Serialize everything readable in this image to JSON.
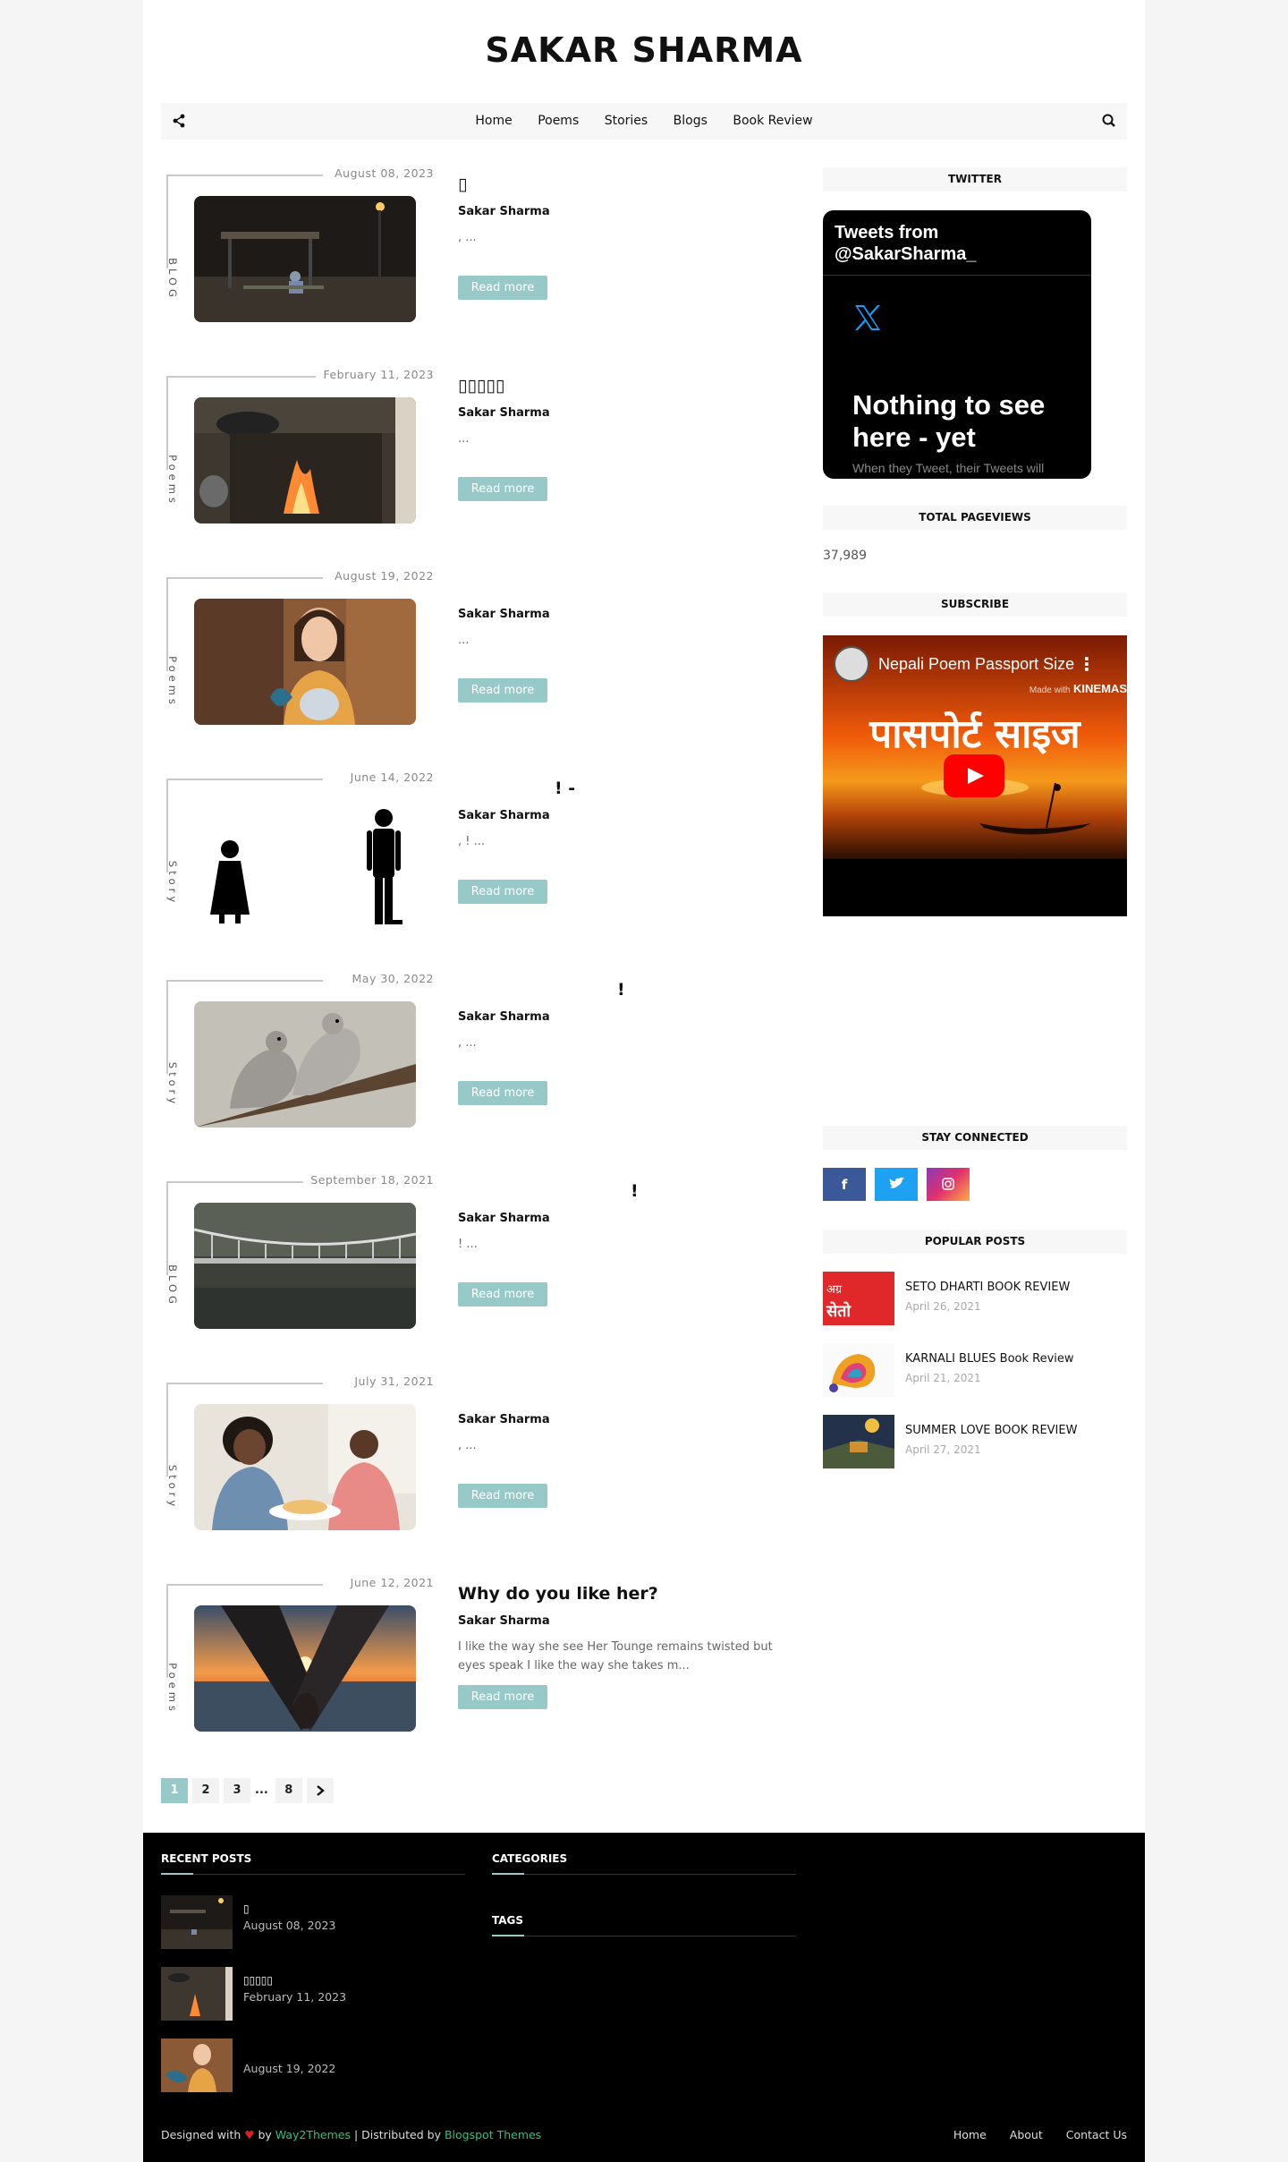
{
  "site": {
    "title": "SAKAR SHARMA"
  },
  "nav": {
    "items": [
      "Home",
      "Poems",
      "Stories",
      "Blogs",
      "Book Review"
    ],
    "share_icon": "share-icon",
    "search_icon": "search-icon"
  },
  "posts": [
    {
      "date": "August 08, 2023",
      "category": "BLOG",
      "title": "▯",
      "author": "Sakar Sharma",
      "snippet": "                                  ,                   ...",
      "read_more": "Read more"
    },
    {
      "date": "February 11, 2023",
      "category": "Poems",
      "title": "▯▯▯▯▯",
      "author": "Sakar Sharma",
      "snippet": "                                                          ...",
      "read_more": "Read more"
    },
    {
      "date": "August 19, 2022",
      "category": "Poems",
      "title": "",
      "author": "Sakar Sharma",
      "snippet": "                                                            ...",
      "read_more": "Read more"
    },
    {
      "date": "June 14, 2022",
      "category": "Story",
      "title": "! -",
      "author": "Sakar Sharma",
      "snippet": "                                                       ,                                     !         ...",
      "read_more": "Read more"
    },
    {
      "date": "May 30, 2022",
      "category": "Story",
      "title": "!",
      "author": "Sakar Sharma",
      "snippet": "                                                            ,                                                          ...",
      "read_more": "Read more"
    },
    {
      "date": "September 18, 2021",
      "category": "BLOG",
      "title": "!",
      "author": "Sakar Sharma",
      "snippet": "                                   !                     ...",
      "read_more": "Read more"
    },
    {
      "date": "July 31, 2021",
      "category": "Story",
      "title": "",
      "author": "Sakar Sharma",
      "snippet": "                                 ,                      ...",
      "read_more": "Read more"
    },
    {
      "date": "June 12, 2021",
      "category": "Poems",
      "title": "Why do you like her?",
      "author": "Sakar Sharma",
      "snippet": "I like the way she see Her Tounge remains twisted but eyes speak I like the way she takes m...",
      "read_more": "Read more"
    }
  ],
  "pagination": {
    "pages": [
      "1",
      "2",
      "3",
      "...",
      "8"
    ],
    "active": "1",
    "next_icon": "chevron-right-icon"
  },
  "sidebar": {
    "twitter": {
      "title": "TWITTER",
      "heading": "Tweets from @SakarSharma_",
      "empty_title": "Nothing to see here - yet",
      "empty_sub": "When they Tweet, their Tweets will"
    },
    "pageviews": {
      "title": "TOTAL PAGEVIEWS",
      "count": "37,989"
    },
    "subscribe": {
      "title": "SUBSCRIBE",
      "video_title": "Nepali Poem Passport Size",
      "made_with": "Made with",
      "kinemaster": "KINEMAS",
      "video_text": "पासपोर्ट साइज"
    },
    "stay_connected": {
      "title": "STAY CONNECTED",
      "icons": [
        "facebook-icon",
        "twitter-icon",
        "instagram-icon"
      ]
    },
    "popular": {
      "title": "POPULAR POSTS",
      "items": [
        {
          "title": "SETO DHARTI BOOK REVIEW",
          "date": "April 26, 2021"
        },
        {
          "title": "KARNALI BLUES Book Review",
          "date": "April 21, 2021"
        },
        {
          "title": "SUMMER LOVE BOOK REVIEW",
          "date": "April 27, 2021"
        }
      ]
    }
  },
  "footer": {
    "recent_title": "RECENT POSTS",
    "categories_title": "CATEGORIES",
    "tags_title": "TAGS",
    "recent": [
      {
        "title": "▯",
        "date": "August 08, 2023"
      },
      {
        "title": "▯▯▯▯▯",
        "date": "February 11, 2023"
      },
      {
        "title": "",
        "date": "August 19, 2022"
      }
    ],
    "designed_with": "Designed with",
    "by": "by",
    "way2themes": "Way2Themes",
    "distributed": "| Distributed by",
    "blogspot": "Blogspot Themes",
    "links": [
      "Home",
      "About",
      "Contact Us"
    ]
  },
  "colors": {
    "accent": "#97c9c8",
    "footer_bg": "#000000",
    "link_green": "#2ec27e",
    "facebook": "#3b5998",
    "twitter": "#1da1f2",
    "instagram": "#c13584"
  }
}
